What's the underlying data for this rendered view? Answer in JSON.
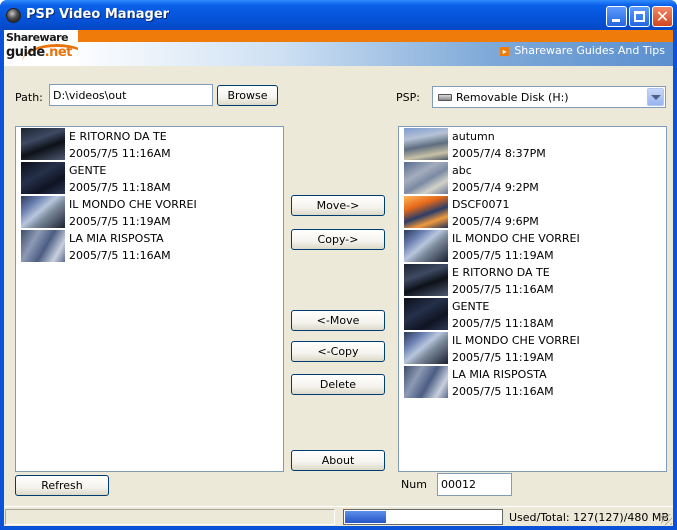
{
  "window": {
    "title": "PSP Video Manager"
  },
  "banner": {
    "logo_line1": "Shareware",
    "logo_line2_a": "guide",
    "logo_line2_b": ".net",
    "tagline": "Shareware Guides And Tips",
    "tagline_icon": "arrow-right-icon"
  },
  "path": {
    "label": "Path:",
    "value": "D:\\videos\\out",
    "browse_label": "Browse"
  },
  "psp": {
    "label": "PSP:",
    "drive_selected": "Removable Disk (H:)",
    "drive_icon": "removable-disk-icon"
  },
  "local_videos": [
    {
      "name": "E RITORNO DA TE",
      "date": "2005/7/5 11:16AM",
      "thumb": "t-dark"
    },
    {
      "name": "GENTE",
      "date": "2005/7/5 11:18AM",
      "thumb": "t-night"
    },
    {
      "name": "IL MONDO CHE VORREI",
      "date": "2005/7/5 11:19AM",
      "thumb": "t-map"
    },
    {
      "name": "LA MIA RISPOSTA",
      "date": "2005/7/5 11:16AM",
      "thumb": "t-crowd"
    }
  ],
  "psp_videos": [
    {
      "name": "autumn",
      "date": "2005/7/4 8:37PM",
      "thumb": "t-autumn"
    },
    {
      "name": "abc",
      "date": "2005/7/4 9:2PM",
      "thumb": "t-abc"
    },
    {
      "name": "DSCF0071",
      "date": "2005/7/4 9:6PM",
      "thumb": "t-dscf"
    },
    {
      "name": "IL MONDO CHE VORREI",
      "date": "2005/7/5 11:19AM",
      "thumb": "t-map"
    },
    {
      "name": "E RITORNO DA TE",
      "date": "2005/7/5 11:16AM",
      "thumb": "t-dark"
    },
    {
      "name": "GENTE",
      "date": "2005/7/5 11:18AM",
      "thumb": "t-night"
    },
    {
      "name": "IL MONDO CHE VORREI",
      "date": "2005/7/5 11:19AM",
      "thumb": "t-map"
    },
    {
      "name": "LA MIA RISPOSTA",
      "date": "2005/7/5 11:16AM",
      "thumb": "t-crowd"
    }
  ],
  "actions": {
    "move_to_psp": "Move->",
    "copy_to_psp": "Copy->",
    "move_from_psp": "<-Move",
    "copy_from_psp": "<-Copy",
    "delete": "Delete",
    "about": "About",
    "refresh": "Refresh"
  },
  "num": {
    "label": "Num",
    "value": "00012"
  },
  "status": {
    "usage_fraction": 0.265,
    "usage_text": "Used/Total:  127(127)/480 MB"
  }
}
